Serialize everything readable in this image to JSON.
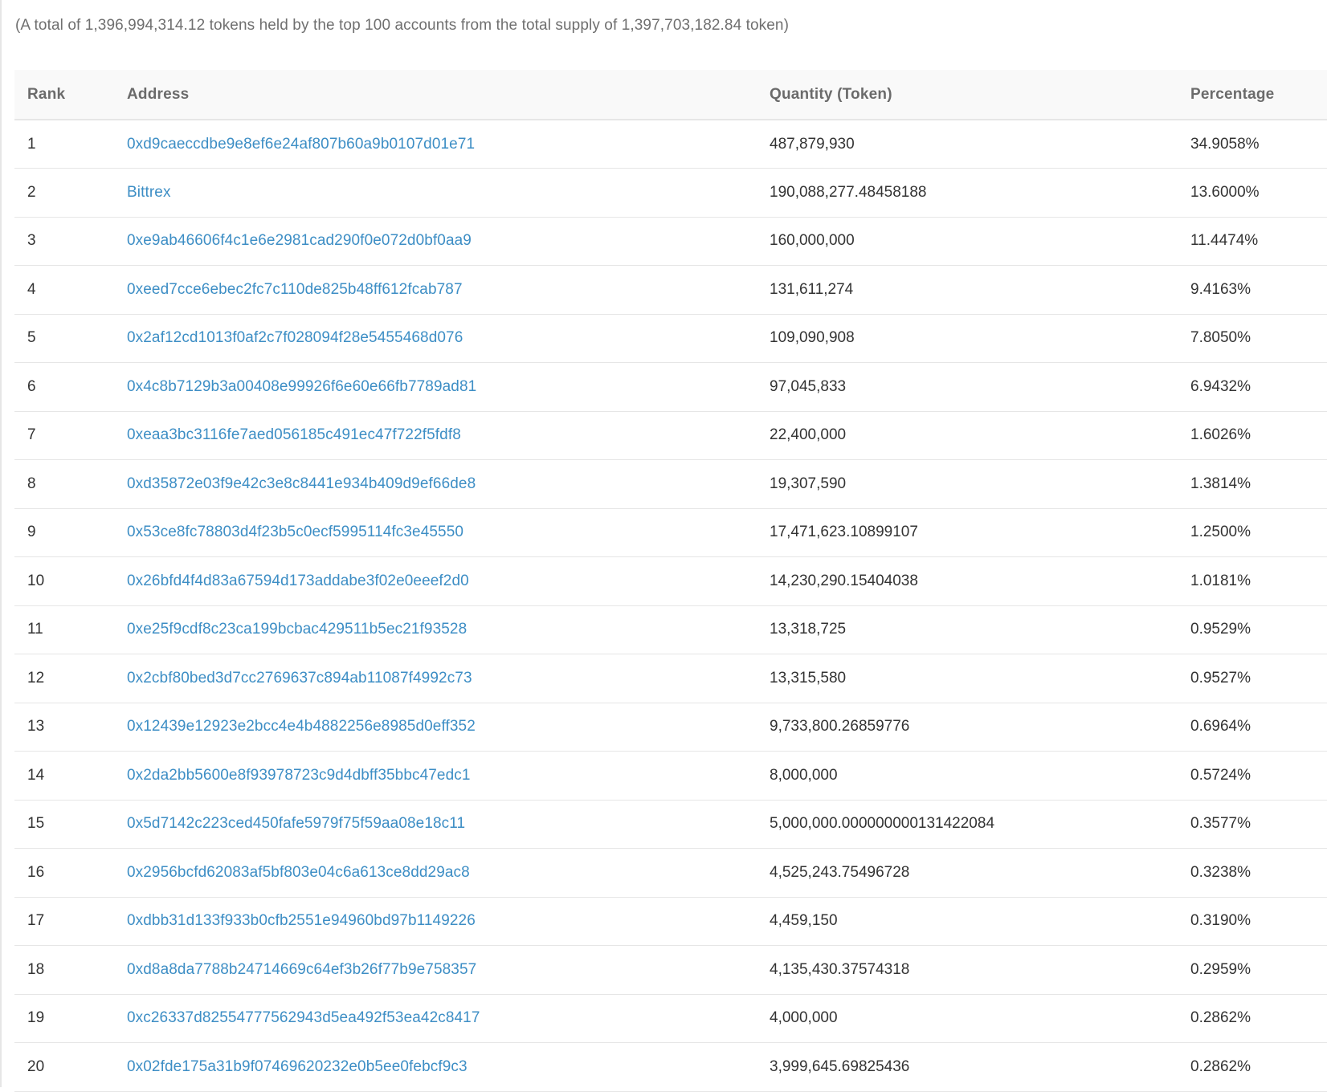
{
  "summary": {
    "text": "(A total of 1,396,994,314.12 tokens held by the top 100 accounts from the total supply of 1,397,703,182.84 token)"
  },
  "table": {
    "headers": {
      "rank": "Rank",
      "address": "Address",
      "quantity": "Quantity (Token)",
      "percentage": "Percentage"
    },
    "rows": [
      {
        "rank": "1",
        "address": "0xd9caeccdbe9e8ef6e24af807b60a9b0107d01e71",
        "quantity": "487,879,930",
        "percentage": "34.9058%"
      },
      {
        "rank": "2",
        "address": "Bittrex",
        "quantity": "190,088,277.48458188",
        "percentage": "13.6000%"
      },
      {
        "rank": "3",
        "address": "0xe9ab46606f4c1e6e2981cad290f0e072d0bf0aa9",
        "quantity": "160,000,000",
        "percentage": "11.4474%"
      },
      {
        "rank": "4",
        "address": "0xeed7cce6ebec2fc7c110de825b48ff612fcab787",
        "quantity": "131,611,274",
        "percentage": "9.4163%"
      },
      {
        "rank": "5",
        "address": "0x2af12cd1013f0af2c7f028094f28e5455468d076",
        "quantity": "109,090,908",
        "percentage": "7.8050%"
      },
      {
        "rank": "6",
        "address": "0x4c8b7129b3a00408e99926f6e60e66fb7789ad81",
        "quantity": "97,045,833",
        "percentage": "6.9432%"
      },
      {
        "rank": "7",
        "address": "0xeaa3bc3116fe7aed056185c491ec47f722f5fdf8",
        "quantity": "22,400,000",
        "percentage": "1.6026%"
      },
      {
        "rank": "8",
        "address": "0xd35872e03f9e42c3e8c8441e934b409d9ef66de8",
        "quantity": "19,307,590",
        "percentage": "1.3814%"
      },
      {
        "rank": "9",
        "address": "0x53ce8fc78803d4f23b5c0ecf5995114fc3e45550",
        "quantity": "17,471,623.10899107",
        "percentage": "1.2500%"
      },
      {
        "rank": "10",
        "address": "0x26bfd4f4d83a67594d173addabe3f02e0eeef2d0",
        "quantity": "14,230,290.15404038",
        "percentage": "1.0181%"
      },
      {
        "rank": "11",
        "address": "0xe25f9cdf8c23ca199bcbac429511b5ec21f93528",
        "quantity": "13,318,725",
        "percentage": "0.9529%"
      },
      {
        "rank": "12",
        "address": "0x2cbf80bed3d7cc2769637c894ab11087f4992c73",
        "quantity": "13,315,580",
        "percentage": "0.9527%"
      },
      {
        "rank": "13",
        "address": "0x12439e12923e2bcc4e4b4882256e8985d0eff352",
        "quantity": "9,733,800.26859776",
        "percentage": "0.6964%"
      },
      {
        "rank": "14",
        "address": "0x2da2bb5600e8f93978723c9d4dbff35bbc47edc1",
        "quantity": "8,000,000",
        "percentage": "0.5724%"
      },
      {
        "rank": "15",
        "address": "0x5d7142c223ced450fafe5979f75f59aa08e18c11",
        "quantity": "5,000,000.000000000131422084",
        "percentage": "0.3577%"
      },
      {
        "rank": "16",
        "address": "0x2956bcfd62083af5bf803e04c6a613ce8dd29ac8",
        "quantity": "4,525,243.75496728",
        "percentage": "0.3238%"
      },
      {
        "rank": "17",
        "address": "0xdbb31d133f933b0cfb2551e94960bd97b1149226",
        "quantity": "4,459,150",
        "percentage": "0.3190%"
      },
      {
        "rank": "18",
        "address": "0xd8a8da7788b24714669c64ef3b26f77b9e758357",
        "quantity": "4,135,430.37574318",
        "percentage": "0.2959%"
      },
      {
        "rank": "19",
        "address": "0xc26337d82554777562943d5ea492f53ea42c8417",
        "quantity": "4,000,000",
        "percentage": "0.2862%"
      },
      {
        "rank": "20",
        "address": "0x02fde175a31b9f07469620232e0b5ee0febcf9c3",
        "quantity": "3,999,645.69825436",
        "percentage": "0.2862%"
      }
    ]
  },
  "colors": {
    "link": "#3d8ec5",
    "text": "#333333",
    "muted": "#6f6f6f",
    "header_bg": "#f9f9f9",
    "border": "#e6e6e6"
  }
}
